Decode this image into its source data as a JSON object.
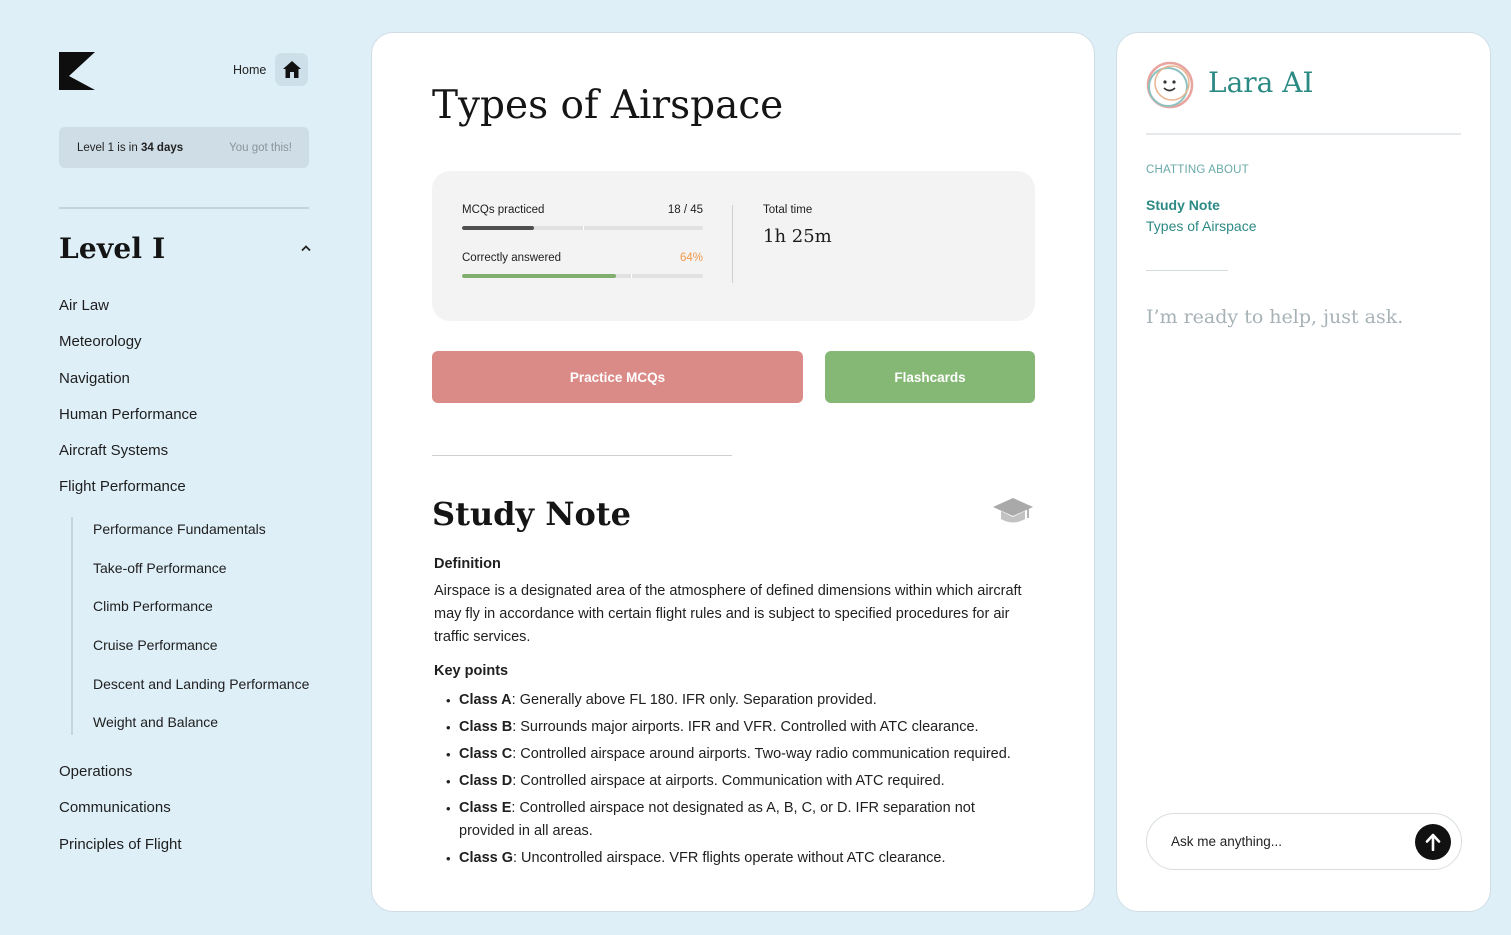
{
  "sidebar": {
    "home_label": "Home",
    "countdown": {
      "prefix": "Level 1 is in ",
      "days": "34 days",
      "encouragement": "You got this!"
    },
    "level_title": "Level I",
    "topics_top": [
      "Air Law",
      "Meteorology",
      "Navigation",
      "Human Performance",
      "Aircraft Systems",
      "Flight Performance"
    ],
    "subtopics": [
      "Performance Fundamentals",
      "Take-off Performance",
      "Climb Performance",
      "Cruise Performance",
      "Descent and Landing Performance",
      "Weight and Balance"
    ],
    "topics_bottom": [
      "Operations",
      "Communications",
      "Principles of Flight"
    ]
  },
  "main": {
    "title": "Types of Airspace",
    "stats": {
      "mcq_label": "MCQs practiced",
      "mcq_value": "18 / 45",
      "mcq_progress": 0.3,
      "correct_label": "Correctly answered",
      "correct_value": "64%",
      "correct_progress": 0.64,
      "total_label": "Total time",
      "total_value": "1h 25m"
    },
    "practice_button": "Practice MCQs",
    "flashcards_button": "Flashcards",
    "note_title": "Study Note",
    "definition_heading": "Definition",
    "definition_text": "Airspace is a designated area of the atmosphere of defined dimensions within which aircraft may fly in accordance with certain flight rules and is subject to specified procedures for air traffic services.",
    "keypoints_heading": "Key points",
    "keypoints": [
      {
        "label": "Class A",
        "text": ": Generally above FL 180. IFR only. Separation provided."
      },
      {
        "label": "Class B",
        "text": ": Surrounds major airports. IFR and VFR. Controlled with ATC clearance."
      },
      {
        "label": "Class C",
        "text": ": Controlled airspace around airports. Two-way radio communication required."
      },
      {
        "label": "Class D",
        "text": ": Controlled airspace at airports. Communication with ATC required."
      },
      {
        "label": "Class E",
        "text": ": Controlled airspace not designated as A, B, C, or D. IFR separation not provided in all areas."
      },
      {
        "label": "Class G",
        "text": ": Uncontrolled airspace. VFR flights operate without ATC clearance."
      }
    ]
  },
  "chat": {
    "name": "Lara AI",
    "about_label": "CHATTING ABOUT",
    "about_title": "Study Note",
    "about_subtitle": "Types of Airspace",
    "ready_text": "I’m ready to help, just ask.",
    "input_placeholder": "Ask me anything..."
  },
  "colors": {
    "background": "#deeff8",
    "practice": "#db8b87",
    "flashcards": "#85b775",
    "accent_teal": "#2c8a85",
    "percent_orange": "#f29a4a",
    "progress_dark": "#4f4f4f",
    "progress_green": "#7fae6e"
  },
  "icons": [
    "logo-icon",
    "home-icon",
    "chevron-up-icon",
    "graduation-cap-icon",
    "avatar-icon",
    "send-arrow-icon"
  ]
}
